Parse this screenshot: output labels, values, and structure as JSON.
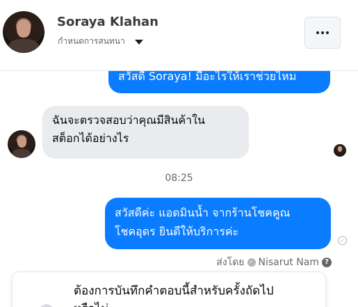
{
  "header": {
    "contact_name": "Soraya Klahan",
    "sub_label": "กำหนดการสนทนา",
    "more_button": "..."
  },
  "messages": {
    "top_outgoing": "สวัสดี Soraya! มีอะไรให้เราช่วยไหม",
    "incoming_line1": "ฉันจะตรวจสอบว่าคุณมีสินค้าใน",
    "incoming_line2": "สต็อกได้อย่างไร",
    "timestamp": "08:25",
    "outgoing_line1": "สวัสดีค่ะ แอดมินน้ำ จากร้านโชคคูณ",
    "outgoing_line2": "โชคอุดร ยินดีให้บริการค่ะ",
    "sent_by_label": "ส่งโดย",
    "sent_by_name": "Nisarut Nam"
  },
  "card": {
    "line1": "ต้องการบันทึกคำตอบนี้สำหรับครั้งถัดไป",
    "line2": "หรือไม่"
  },
  "colors": {
    "outgoing_bubble": "#0a7cff",
    "incoming_bubble": "#e9ebee"
  },
  "icons": {
    "more": "more-dots-icon",
    "dropdown": "caret-down-icon",
    "check": "check-icon",
    "help": "help-icon",
    "status": "sent-status-icon"
  }
}
